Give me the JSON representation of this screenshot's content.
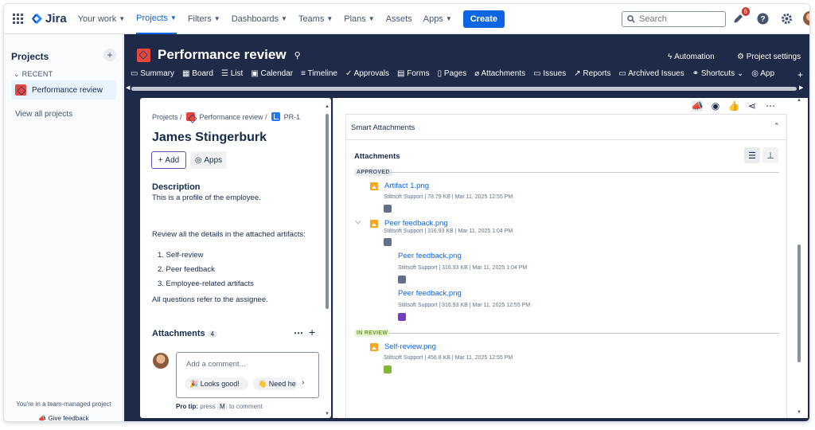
{
  "topnav": {
    "logo": "Jira",
    "items": [
      "Your work",
      "Projects",
      "Filters",
      "Dashboards",
      "Teams",
      "Plans",
      "Assets",
      "Apps"
    ],
    "create_label": "Create",
    "search_placeholder": "Search",
    "notif_count": "6"
  },
  "sidebar": {
    "title": "Projects",
    "recent_label": "RECENT",
    "project": "Performance review",
    "view_all": "View all projects",
    "team_note": "You're in a team-managed project",
    "feedback": "Give feedback"
  },
  "project": {
    "title": "Performance review",
    "automation": "Automation",
    "settings": "Project settings",
    "tabs": [
      "Summary",
      "Board",
      "List",
      "Calendar",
      "Timeline",
      "Approvals",
      "Forms",
      "Pages",
      "Attachments",
      "Issues",
      "Reports",
      "Archived Issues",
      "Shortcuts",
      "App"
    ]
  },
  "issue": {
    "breadcrumb": [
      "Projects",
      "Performance review",
      "PR-1"
    ],
    "title": "James Stingerburk",
    "add_label": "Add",
    "apps_label": "Apps",
    "description_label": "Description",
    "desc_line1": "This is a profile of the employee.",
    "desc_line2": "Review all the details in the attached artifacts:",
    "list": [
      "1. Self-review",
      "2. Peer feedback",
      "3. Employee-related artifacts"
    ],
    "desc_line3": "All questions refer to the assignee.",
    "attachments_label": "Attachments",
    "attachments_count": "4",
    "comment_placeholder": "Add a comment...",
    "chip1": "Looks good!",
    "chip2": "Need he",
    "protip_label": "Pro tip:",
    "protip_text1": "press",
    "protip_key": "M",
    "protip_text2": "to comment"
  },
  "smart": {
    "title": "Smart Attachments",
    "attachments_heading": "Attachments",
    "group_approved": "APPROVED",
    "group_review": "IN REVIEW",
    "files": [
      {
        "name": "Artifact 1.png",
        "meta": "Stiltsoft Support | 78.79 KB | Mar 11, 2025 12:55 PM",
        "color": "#626f86"
      },
      {
        "name": "Peer feedback.png",
        "meta": "Stiltsoft Support | 316.93 KB | Mar 11, 2025 1:04 PM",
        "color": "#626f86"
      },
      {
        "name": "Peer feedback.png",
        "meta": "Stiltsoft Support | 316.93 KB | Mar 11, 2025 1:04 PM",
        "color": "#626f86"
      },
      {
        "name": "Peer feedback.png",
        "meta": "Stiltsoft Support | 316.93 KB | Mar 11, 2025 12:55 PM",
        "color": "#6e3fb8"
      },
      {
        "name": "Self-review.png",
        "meta": "Stiltsoft Support | 456.8 KB | Mar 11, 2025 12:55 PM",
        "color": "#82b536"
      }
    ]
  },
  "colors": {
    "accent": "#0c66e4",
    "header_bg": "#1e2a47",
    "project_icon": "#e2483d"
  }
}
